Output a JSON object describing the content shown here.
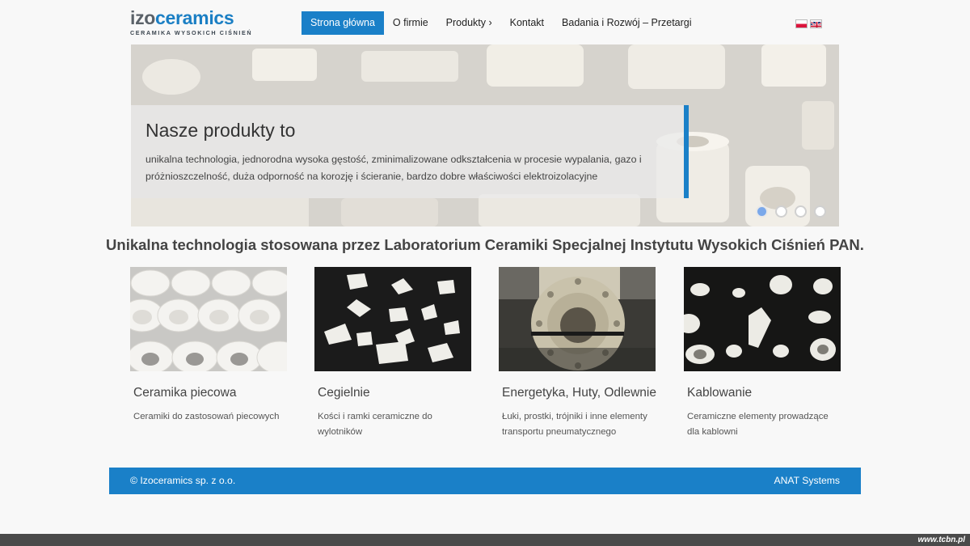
{
  "logo": {
    "part1": "izo",
    "part2": "ceramics",
    "tagline": "CERAMIKA WYSOKICH CIŚNIEŃ"
  },
  "nav": {
    "items": [
      {
        "label": "Strona główna",
        "active": true
      },
      {
        "label": "O firmie"
      },
      {
        "label": "Produkty ›"
      },
      {
        "label": "Kontakt"
      },
      {
        "label": "Badania i Rozwój – Przetargi"
      }
    ]
  },
  "languages": [
    "pl-flag-icon",
    "uk-flag-icon"
  ],
  "slider": {
    "title": "Nasze produkty to",
    "text": "unikalna technologia, jednorodna wysoka gęstość, zminimalizowane odkształcenia w procesie wypalania, gazo i próżnioszczelność, duża odporność na korozję i ścieranie, bardzo dobre właściwości elektroizolacyjne",
    "active_slide": 1,
    "slide_count": 4
  },
  "headline": "Unikalna technologia stosowana przez Laboratorium Ceramiki Specjalnej Instytutu Wysokich Ciśnień PAN.",
  "cards": [
    {
      "title": "Ceramika piecowa",
      "text": "Ceramiki do zastosowań piecowych"
    },
    {
      "title": "Cegielnie",
      "text": "Kości i ramki ceramiczne do wylotników"
    },
    {
      "title": "Energetyka, Huty, Odlewnie",
      "text": "Łuki, prostki, trójniki i inne elementy transportu pneumatycznego"
    },
    {
      "title": "Kablowanie",
      "text": "Ceramiczne elementy prowadzące dla kablowni"
    }
  ],
  "footer": {
    "copyright": "© Izoceramics sp. z o.o.",
    "credit": "ANAT Systems"
  },
  "watermark": "www.tcbn.pl",
  "colors": {
    "accent": "#1a80c8",
    "background": "#f8f8f8",
    "bottom_bar": "#4a4a4a"
  }
}
